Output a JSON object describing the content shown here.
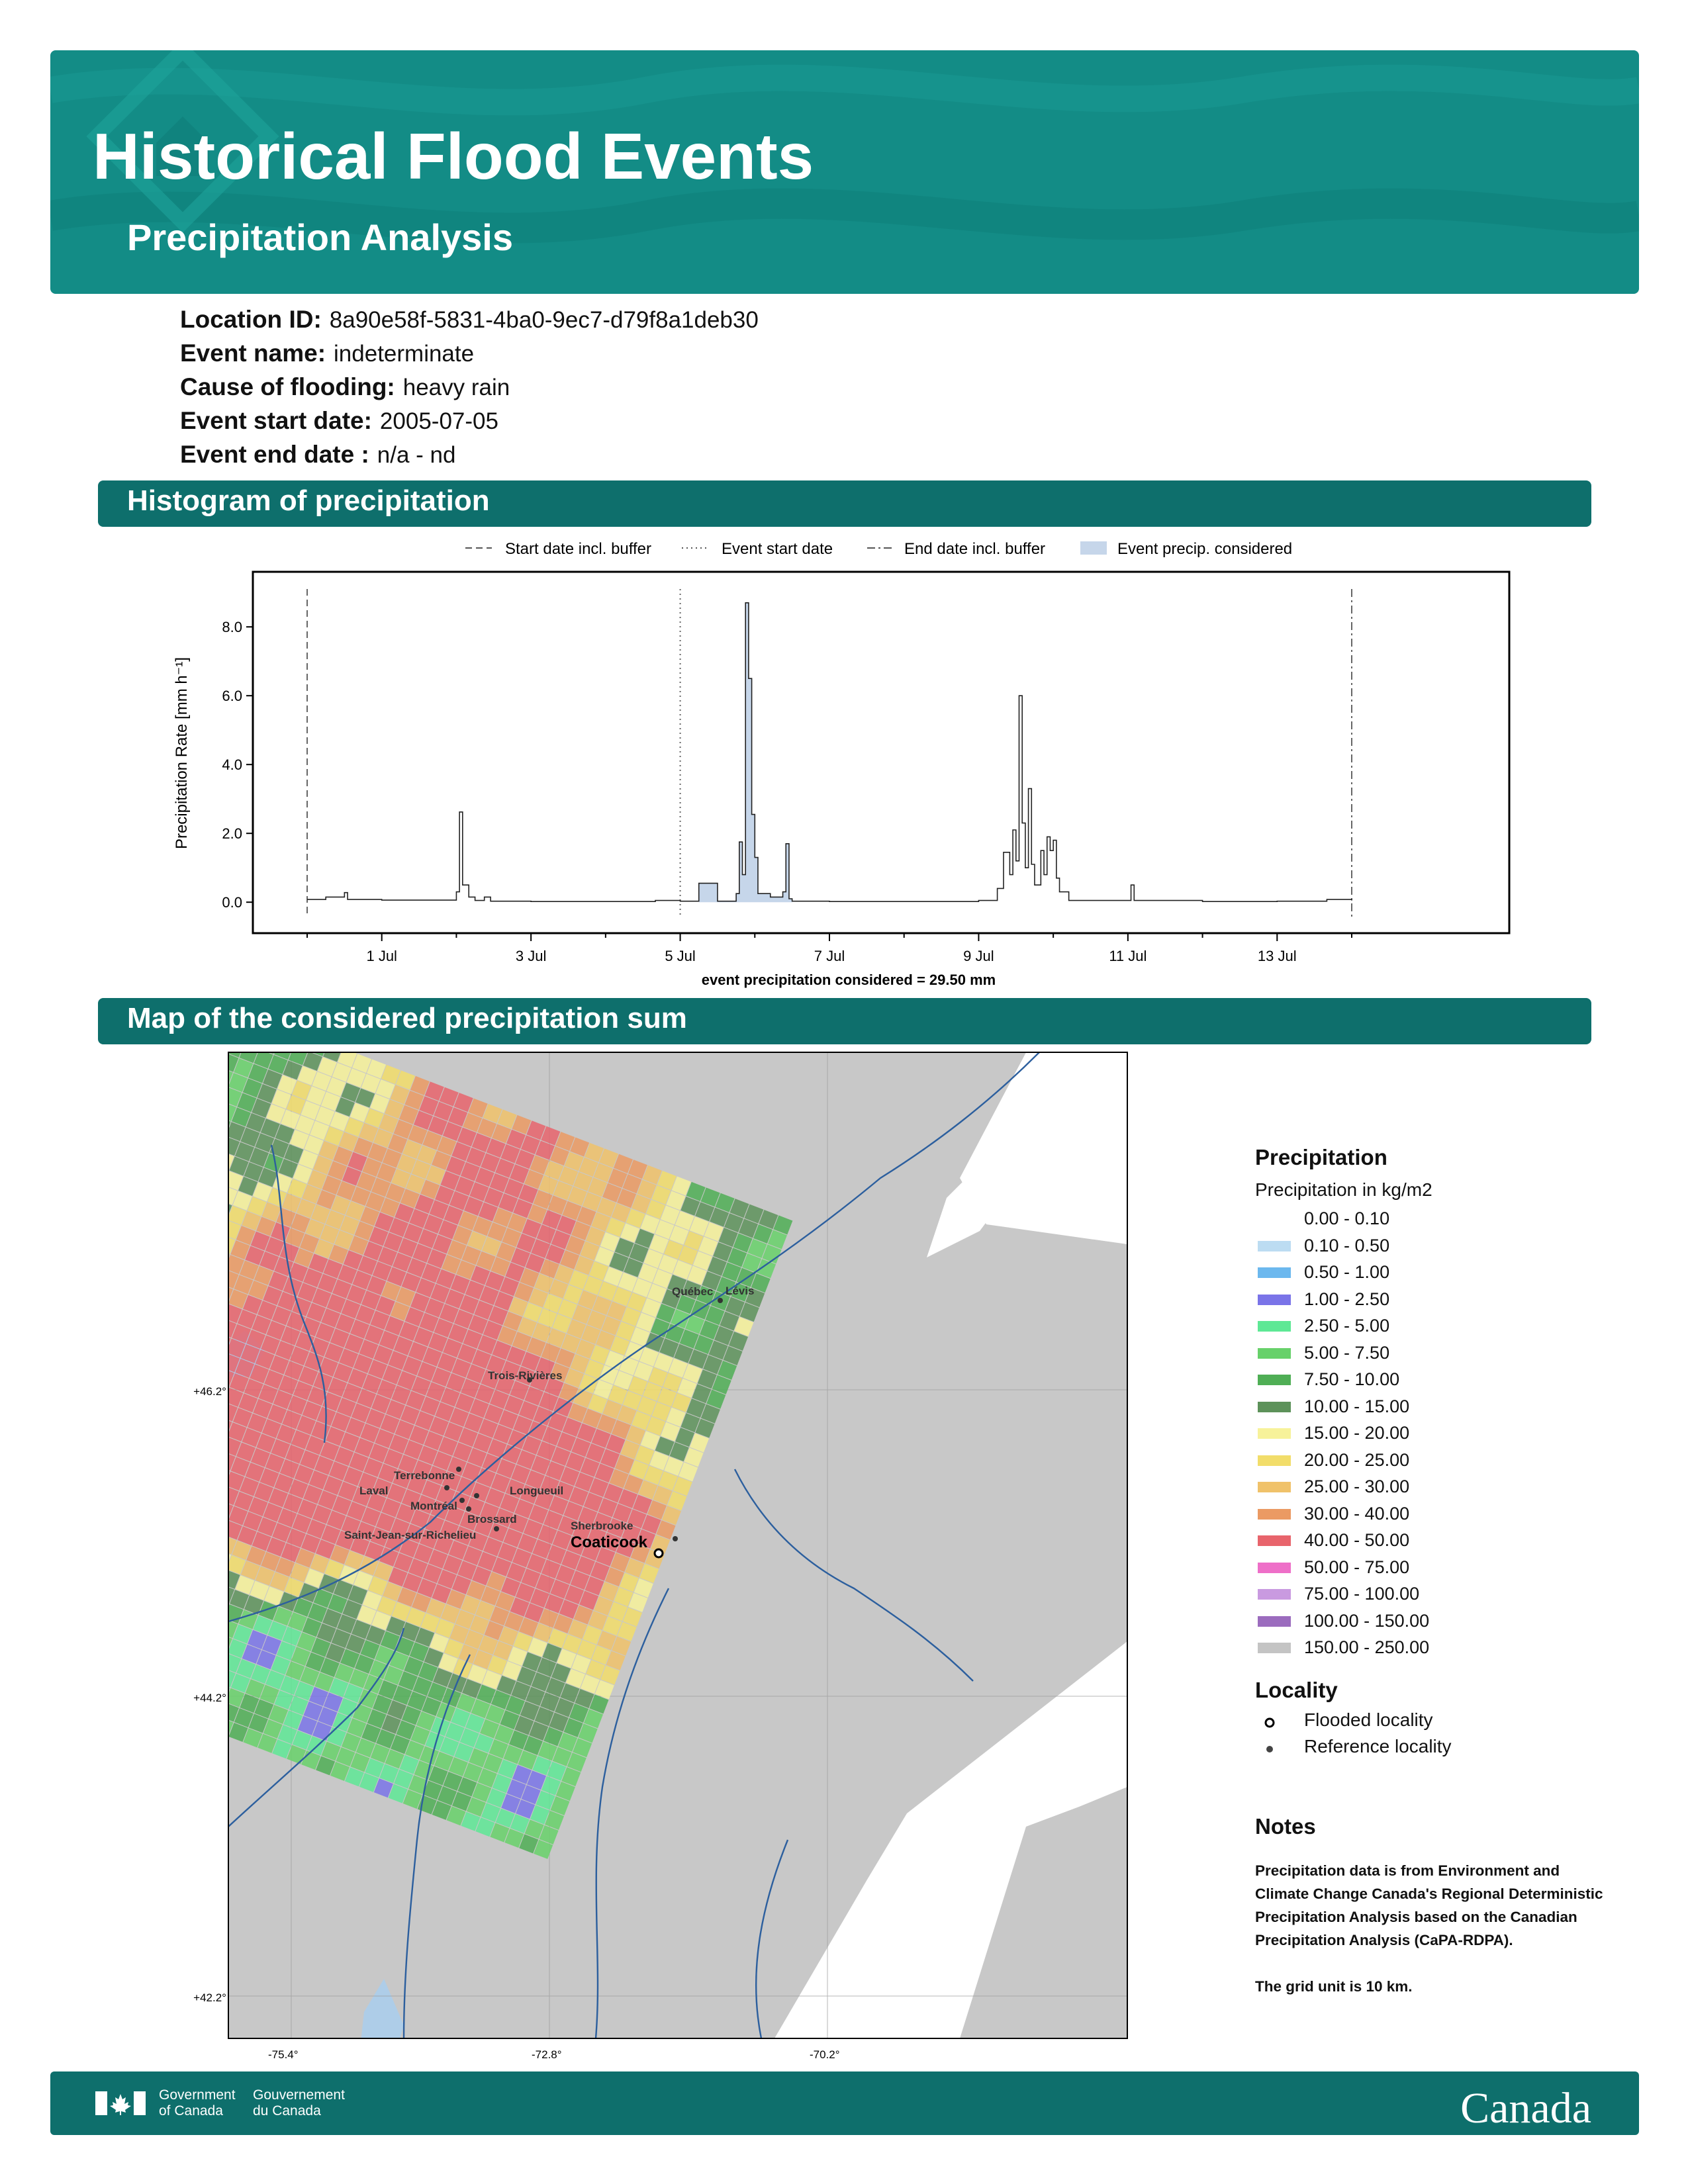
{
  "header": {
    "title": "Historical Flood Events",
    "subtitle": "Precipitation Analysis"
  },
  "info": [
    {
      "key": "Location ID:",
      "value": "8a90e58f-5831-4ba0-9ec7-d79f8a1deb30"
    },
    {
      "key": "Event name:",
      "value": "indeterminate"
    },
    {
      "key": "Cause of flooding:",
      "value": "heavy rain"
    },
    {
      "key": "Event start date:",
      "value": "2005-07-05"
    },
    {
      "key": "Event end date :",
      "value": "n/a - nd"
    }
  ],
  "sections": {
    "histogram": "Histogram of precipitation",
    "map": "Map of the considered precipitation sum"
  },
  "chart_data": {
    "type": "line",
    "style": "step",
    "ylabel": "Precipitation Rate [mm h⁻¹]",
    "xlabel": "event precipitation considered = 29.50 mm",
    "ylim": [
      -0.9,
      9.6
    ],
    "yticks": [
      "0.0",
      "2.0",
      "4.0",
      "6.0",
      "8.0"
    ],
    "xticks": [
      "1 Jul",
      "3 Jul",
      "5 Jul",
      "7 Jul",
      "9 Jul",
      "11 Jul",
      "13 Jul"
    ],
    "legend": [
      "Start date incl. buffer",
      "Event start date",
      "End date incl. buffer",
      "Event precip. considered"
    ],
    "legend_position": "top",
    "markers": {
      "start_buffer": "2005-06-30",
      "event_start": "2005-07-05",
      "end_buffer": "2005-07-14"
    },
    "considered_range": [
      "2005-07-05 06:00",
      "2005-07-06 12:00"
    ],
    "series": [
      {
        "points": [
          [
            "2005-06-30 00:00",
            0.08
          ],
          [
            "2005-06-30 06:00",
            0.15
          ],
          [
            "2005-06-30 12:00",
            0.28
          ],
          [
            "2005-06-30 13:00",
            0.08
          ],
          [
            "2005-07-01 00:00",
            0.06
          ],
          [
            "2005-07-02 00:00",
            0.3
          ],
          [
            "2005-07-02 01:00",
            2.62
          ],
          [
            "2005-07-02 02:00",
            0.5
          ],
          [
            "2005-07-02 04:00",
            0.15
          ],
          [
            "2005-07-02 06:00",
            0.05
          ],
          [
            "2005-07-02 09:00",
            0.15
          ],
          [
            "2005-07-02 11:00",
            0.03
          ],
          [
            "2005-07-03 00:00",
            0.02
          ],
          [
            "2005-07-04 00:00",
            0.02
          ],
          [
            "2005-07-04 16:00",
            0.05
          ],
          [
            "2005-07-05 00:00",
            0.03
          ],
          [
            "2005-07-05 06:00",
            0.55
          ],
          [
            "2005-07-05 12:00",
            0.03
          ],
          [
            "2005-07-05 18:00",
            0.25
          ],
          [
            "2005-07-05 19:00",
            1.75
          ],
          [
            "2005-07-05 20:00",
            0.8
          ],
          [
            "2005-07-05 21:00",
            8.7
          ],
          [
            "2005-07-05 22:00",
            6.5
          ],
          [
            "2005-07-05 23:00",
            2.55
          ],
          [
            "2005-07-06 00:00",
            1.3
          ],
          [
            "2005-07-06 01:00",
            0.25
          ],
          [
            "2005-07-06 05:00",
            0.15
          ],
          [
            "2005-07-06 09:00",
            0.3
          ],
          [
            "2005-07-06 10:00",
            1.7
          ],
          [
            "2005-07-06 11:00",
            0.1
          ],
          [
            "2005-07-06 12:00",
            0.03
          ],
          [
            "2005-07-07 00:00",
            0.02
          ],
          [
            "2005-07-08 00:00",
            0.02
          ],
          [
            "2005-07-09 00:00",
            0.05
          ],
          [
            "2005-07-09 06:00",
            0.4
          ],
          [
            "2005-07-09 08:00",
            1.45
          ],
          [
            "2005-07-09 10:00",
            0.8
          ],
          [
            "2005-07-09 11:00",
            2.1
          ],
          [
            "2005-07-09 12:00",
            1.2
          ],
          [
            "2005-07-09 13:00",
            6.0
          ],
          [
            "2005-07-09 14:00",
            2.3
          ],
          [
            "2005-07-09 15:00",
            1.0
          ],
          [
            "2005-07-09 16:00",
            3.3
          ],
          [
            "2005-07-09 17:00",
            1.1
          ],
          [
            "2005-07-09 18:00",
            0.5
          ],
          [
            "2005-07-09 20:00",
            1.5
          ],
          [
            "2005-07-09 21:00",
            0.8
          ],
          [
            "2005-07-09 22:00",
            1.9
          ],
          [
            "2005-07-09 23:00",
            1.5
          ],
          [
            "2005-07-10 00:00",
            1.8
          ],
          [
            "2005-07-10 01:00",
            0.7
          ],
          [
            "2005-07-10 02:00",
            0.3
          ],
          [
            "2005-07-10 05:00",
            0.05
          ],
          [
            "2005-07-11 00:00",
            0.05
          ],
          [
            "2005-07-11 01:00",
            0.5
          ],
          [
            "2005-07-11 02:00",
            0.05
          ],
          [
            "2005-07-12 00:00",
            0.02
          ],
          [
            "2005-07-13 00:00",
            0.03
          ],
          [
            "2005-07-13 16:00",
            0.08
          ],
          [
            "2005-07-14 00:00",
            0.05
          ]
        ]
      }
    ]
  },
  "map": {
    "lat_labels": [
      "+46.2°",
      "+44.2°",
      "+42.2°"
    ],
    "lon_labels": [
      "-75.4°",
      "-72.8°",
      "-70.2°"
    ],
    "places": {
      "quebec": "Québec",
      "levis": "Lévis",
      "trois_rivieres": "Trois-Rivières",
      "terrebonne": "Terrebonne",
      "laval": "Laval",
      "montreal": "Montréal",
      "longueuil": "Longueuil",
      "brossard": "Brossard",
      "saint_jean": "Saint-Jean-sur-Richelieu",
      "sherbrooke": "Sherbrooke",
      "coaticook": "Coaticook"
    }
  },
  "legend": {
    "title": "Precipitation",
    "subtitle": "Precipitation in kg/m2",
    "items": [
      {
        "label": "0.00 - 0.10",
        "color": "#ffffff"
      },
      {
        "label": "0.10 - 0.50",
        "color": "#bcdcf2"
      },
      {
        "label": "0.50 - 1.00",
        "color": "#6cb8ee"
      },
      {
        "label": "1.00 - 2.50",
        "color": "#7a74e8"
      },
      {
        "label": "2.50 - 5.00",
        "color": "#5ee895"
      },
      {
        "label": "5.00 - 7.50",
        "color": "#67d16a"
      },
      {
        "label": "7.50 - 10.00",
        "color": "#4fae55"
      },
      {
        "label": "10.00 - 15.00",
        "color": "#5d925a"
      },
      {
        "label": "15.00 - 20.00",
        "color": "#f7f29a"
      },
      {
        "label": "20.00 - 25.00",
        "color": "#f2dd6a"
      },
      {
        "label": "25.00 - 30.00",
        "color": "#f0c26a"
      },
      {
        "label": "30.00 - 40.00",
        "color": "#eb9a63"
      },
      {
        "label": "40.00 - 50.00",
        "color": "#e8646c"
      },
      {
        "label": "50.00 - 75.00",
        "color": "#ee6fc8"
      },
      {
        "label": "75.00 - 100.00",
        "color": "#c99ae0"
      },
      {
        "label": "100.00 - 150.00",
        "color": "#9b6cbe"
      },
      {
        "label": "150.00 - 250.00",
        "color": "#c4c4c4"
      }
    ],
    "locality_title": "Locality",
    "flooded": "Flooded locality",
    "reference": "Reference locality"
  },
  "notes": {
    "title": "Notes",
    "p1": "Precipitation data is from Environment and Climate Change Canada's Regional Deterministic Precipitation Analysis based on the Canadian Precipitation Analysis (CaPA-RDPA).",
    "p2": "The grid unit is 10 km."
  },
  "footer": {
    "gov_en_1": "Government",
    "gov_en_2": "of Canada",
    "gov_fr_1": "Gouvernement",
    "gov_fr_2": "du Canada",
    "wordmark": "Canada"
  },
  "colors": {
    "header": "#138c86",
    "band": "#0e6f6c",
    "accent": "#0e6f6c"
  }
}
